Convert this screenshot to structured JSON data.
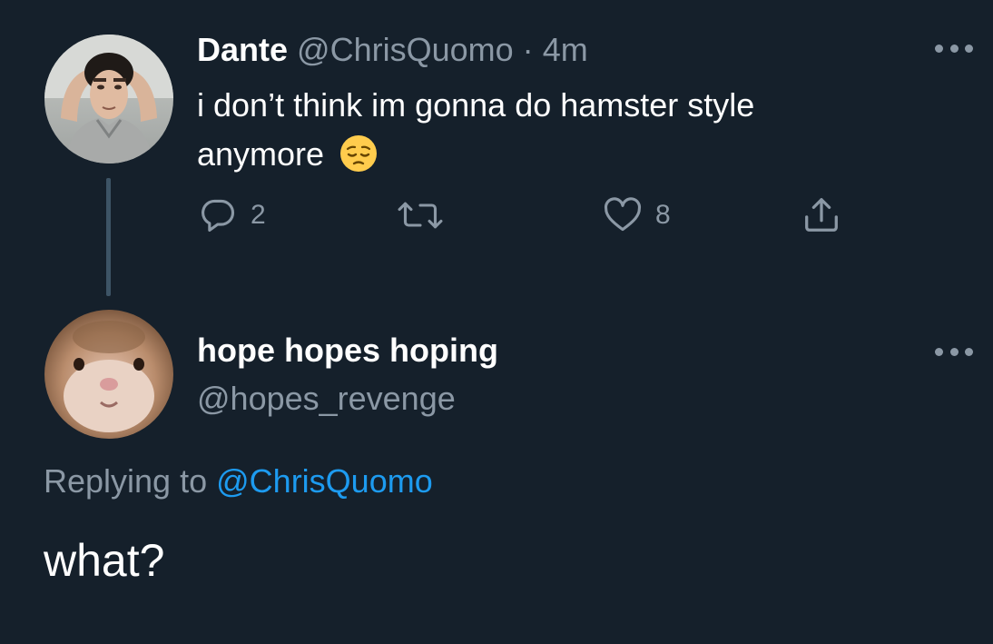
{
  "tweet": {
    "author_name": "Dante",
    "author_handle": "@ChrisQuomo",
    "separator": "·",
    "time": "4m",
    "text": "i don’t think im gonna do hamster style anymore",
    "emoji": "pensive-face",
    "actions": {
      "reply_count": "2",
      "retweet_count": "",
      "like_count": "8"
    }
  },
  "reply": {
    "author_name": "hope hopes hoping",
    "author_handle": "@hopes_revenge",
    "replying_prefix": "Replying to",
    "replying_mention": "@ChrisQuomo",
    "text": "what?"
  },
  "icons": {
    "reply": "speech-bubble-icon",
    "retweet": "retweet-icon",
    "like": "heart-icon",
    "share": "share-upload-icon",
    "more": "more-dots-icon"
  },
  "colors": {
    "background": "#15202b",
    "secondary_text": "#8b98a5",
    "link": "#1d9bf0",
    "thread_line": "#3d5466"
  }
}
